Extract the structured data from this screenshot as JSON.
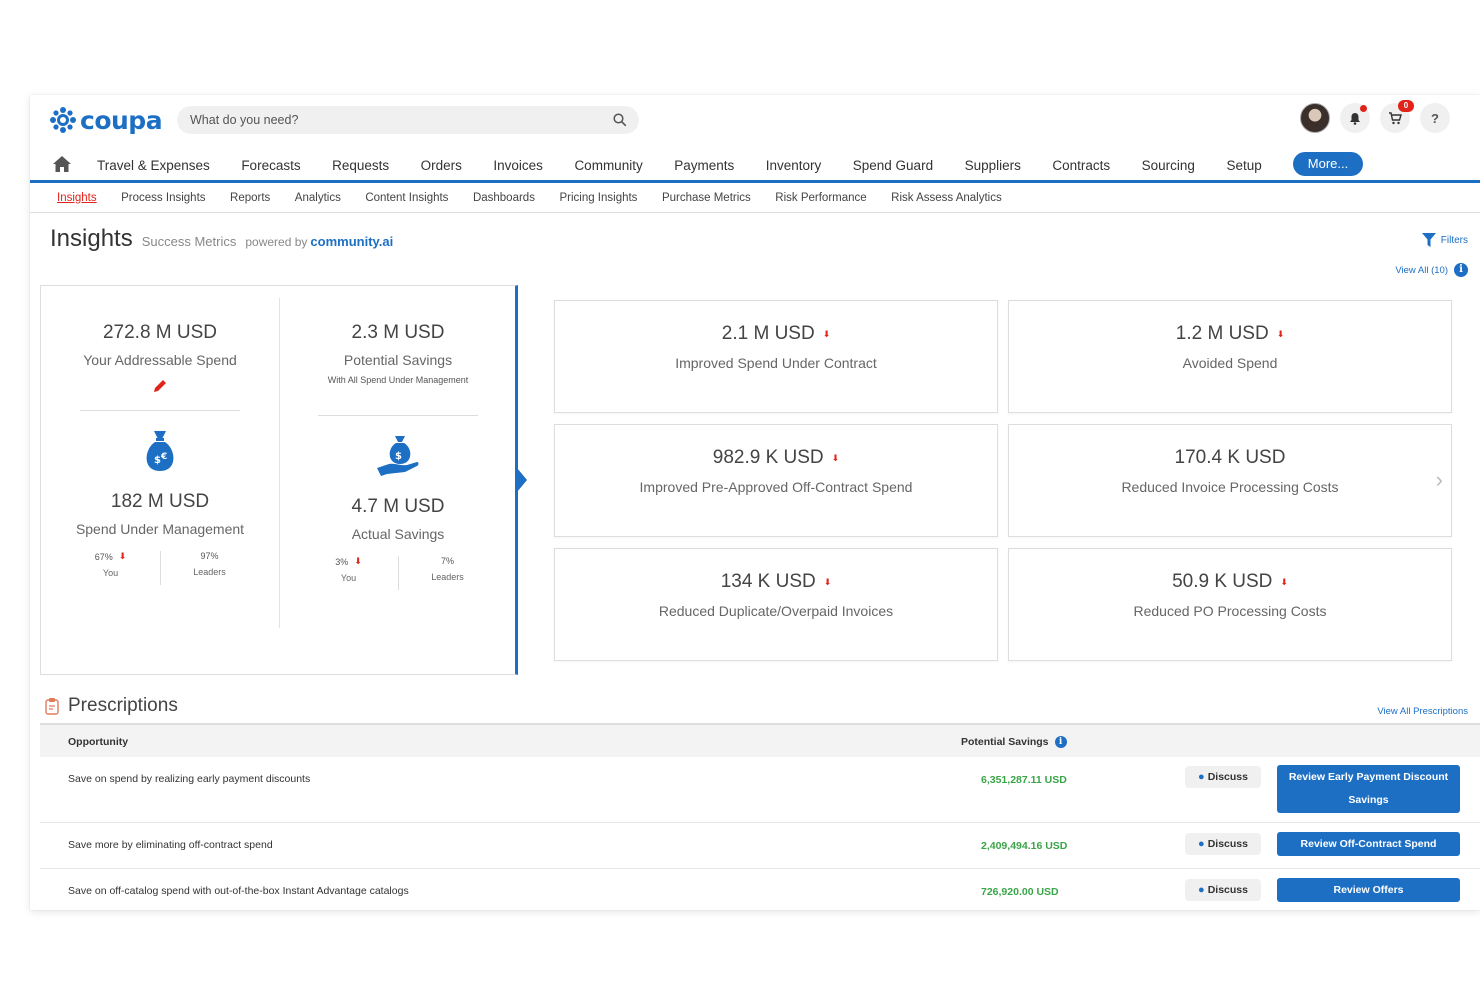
{
  "header": {
    "logo_text": "coupa",
    "search_placeholder": "What do you need?",
    "cart_badge": "0",
    "help_label": "?",
    "brand_color": "#1d6fc4"
  },
  "main_nav": {
    "items": [
      "Travel & Expenses",
      "Forecasts",
      "Requests",
      "Orders",
      "Invoices",
      "Community",
      "Payments",
      "Inventory",
      "Spend Guard",
      "Suppliers",
      "Contracts",
      "Sourcing",
      "Setup"
    ],
    "more_label": "More..."
  },
  "sub_nav": {
    "items": [
      "Insights",
      "Process Insights",
      "Reports",
      "Analytics",
      "Content Insights",
      "Dashboards",
      "Pricing Insights",
      "Purchase Metrics",
      "Risk Performance",
      "Risk Assess Analytics"
    ],
    "active_index": 0
  },
  "page": {
    "title": "Insights",
    "subtitle": "Success Metrics",
    "powered_by": "powered by",
    "powered_brand": "community.ai",
    "filters_label": "Filters",
    "view_all_label": "View All (10)"
  },
  "summary": {
    "addressable": {
      "value": "272.8 M USD",
      "label": "Your Addressable Spend"
    },
    "potential": {
      "value": "2.3 M USD",
      "label": "Potential Savings",
      "sublabel": "With All Spend Under Management"
    },
    "under_mgmt": {
      "value": "182 M USD",
      "label": "Spend Under Management",
      "you_value": "67%",
      "you_label": "You",
      "leaders_value": "97%",
      "leaders_label": "Leaders"
    },
    "actual": {
      "value": "4.7 M USD",
      "label": "Actual Savings",
      "you_value": "3%",
      "you_label": "You",
      "leaders_value": "7%",
      "leaders_label": "Leaders"
    }
  },
  "cards": [
    {
      "value": "2.1 M USD",
      "label": "Improved Spend Under Contract",
      "indicator": true
    },
    {
      "value": "1.2 M USD",
      "label": "Avoided Spend",
      "indicator": true
    },
    {
      "value": "982.9 K USD",
      "label": "Improved Pre-Approved Off-Contract Spend",
      "indicator": true
    },
    {
      "value": "170.4 K USD",
      "label": "Reduced Invoice Processing Costs",
      "indicator": false
    },
    {
      "value": "134 K USD",
      "label": "Reduced Duplicate/Overpaid Invoices",
      "indicator": true
    },
    {
      "value": "50.9 K USD",
      "label": "Reduced PO Processing Costs",
      "indicator": true
    }
  ],
  "prescriptions": {
    "title": "Prescriptions",
    "view_all_label": "View All Prescriptions",
    "col_opportunity": "Opportunity",
    "col_savings": "Potential Savings",
    "discuss_label": "Discuss",
    "savings_color": "#3aa547",
    "rows": [
      {
        "opportunity": "Save on spend by realizing early payment discounts",
        "savings": "6,351,287.11 USD",
        "action_line1": "Review Early Payment Discount",
        "action_line2": "Savings"
      },
      {
        "opportunity": "Save more by eliminating off-contract spend",
        "savings": "2,409,494.16 USD",
        "action_line1": "Review Off-Contract Spend",
        "action_line2": ""
      },
      {
        "opportunity": "Save on off-catalog spend with out-of-the-box Instant Advantage catalogs",
        "savings": "726,920.00 USD",
        "action_line1": "Review Offers",
        "action_line2": ""
      }
    ]
  }
}
